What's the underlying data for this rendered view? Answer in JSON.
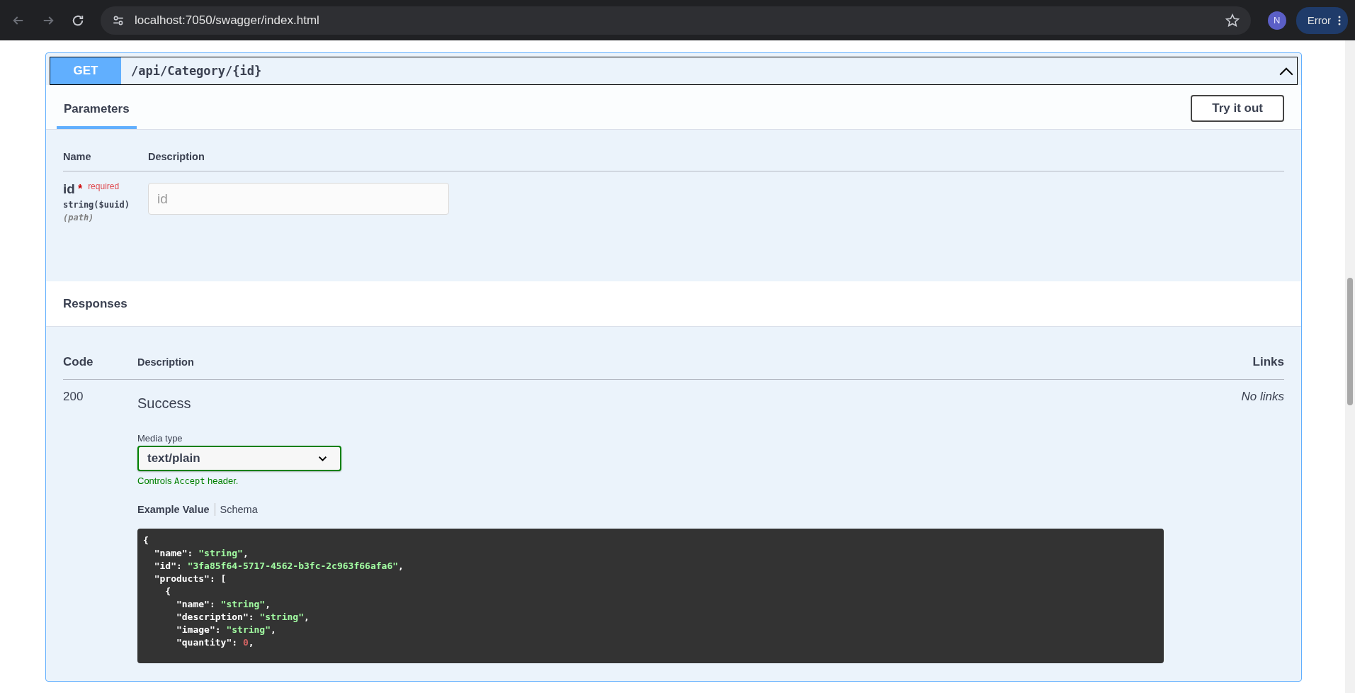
{
  "browser": {
    "url": "localhost:7050/swagger/index.html",
    "profile_initial": "N",
    "error_label": "Error"
  },
  "operation": {
    "method": "GET",
    "path": "/api/Category/{id}",
    "expanded": true
  },
  "parameters": {
    "tabs": [
      {
        "label": "Parameters",
        "selected": true
      }
    ],
    "try_button": "Try it out",
    "columns": [
      "Name",
      "Description"
    ],
    "rows": [
      {
        "name": "id",
        "required_mark": "*",
        "required_label": "required",
        "type": "string",
        "format": "($uuid)",
        "location": "(path)",
        "placeholder": "id"
      }
    ]
  },
  "responses": {
    "title": "Responses",
    "columns": [
      "Code",
      "Description",
      "Links"
    ],
    "rows": [
      {
        "code": "200",
        "description": "Success",
        "links": "No links",
        "media_type_label": "Media type",
        "media_type": "text/plain",
        "controls_note": "Controls **Accept** header.",
        "example_tabs": [
          {
            "label": "Example Value",
            "selected": true
          },
          {
            "label": "Schema",
            "selected": false
          }
        ],
        "example": [
          [
            {
              "kind": "punct",
              "text": "{"
            }
          ],
          [
            {
              "kind": "punct",
              "text": "  \"name\": "
            },
            {
              "kind": "string",
              "text": "\"string\""
            },
            {
              "kind": "punct",
              "text": ","
            }
          ],
          [
            {
              "kind": "punct",
              "text": "  \"id\": "
            },
            {
              "kind": "string",
              "text": "\"3fa85f64-5717-4562-b3fc-2c963f66afa6\""
            },
            {
              "kind": "punct",
              "text": ","
            }
          ],
          [
            {
              "kind": "punct",
              "text": "  \"products\": ["
            }
          ],
          [
            {
              "kind": "punct",
              "text": "    {"
            }
          ],
          [
            {
              "kind": "punct",
              "text": "      \"name\": "
            },
            {
              "kind": "string",
              "text": "\"string\""
            },
            {
              "kind": "punct",
              "text": ","
            }
          ],
          [
            {
              "kind": "punct",
              "text": "      \"description\": "
            },
            {
              "kind": "string",
              "text": "\"string\""
            },
            {
              "kind": "punct",
              "text": ","
            }
          ],
          [
            {
              "kind": "punct",
              "text": "      \"image\": "
            },
            {
              "kind": "string",
              "text": "\"string\""
            },
            {
              "kind": "punct",
              "text": ","
            }
          ],
          [
            {
              "kind": "punct",
              "text": "      \"quantity\": "
            },
            {
              "kind": "number",
              "text": "0"
            },
            {
              "kind": "punct",
              "text": ","
            }
          ]
        ]
      }
    ]
  }
}
